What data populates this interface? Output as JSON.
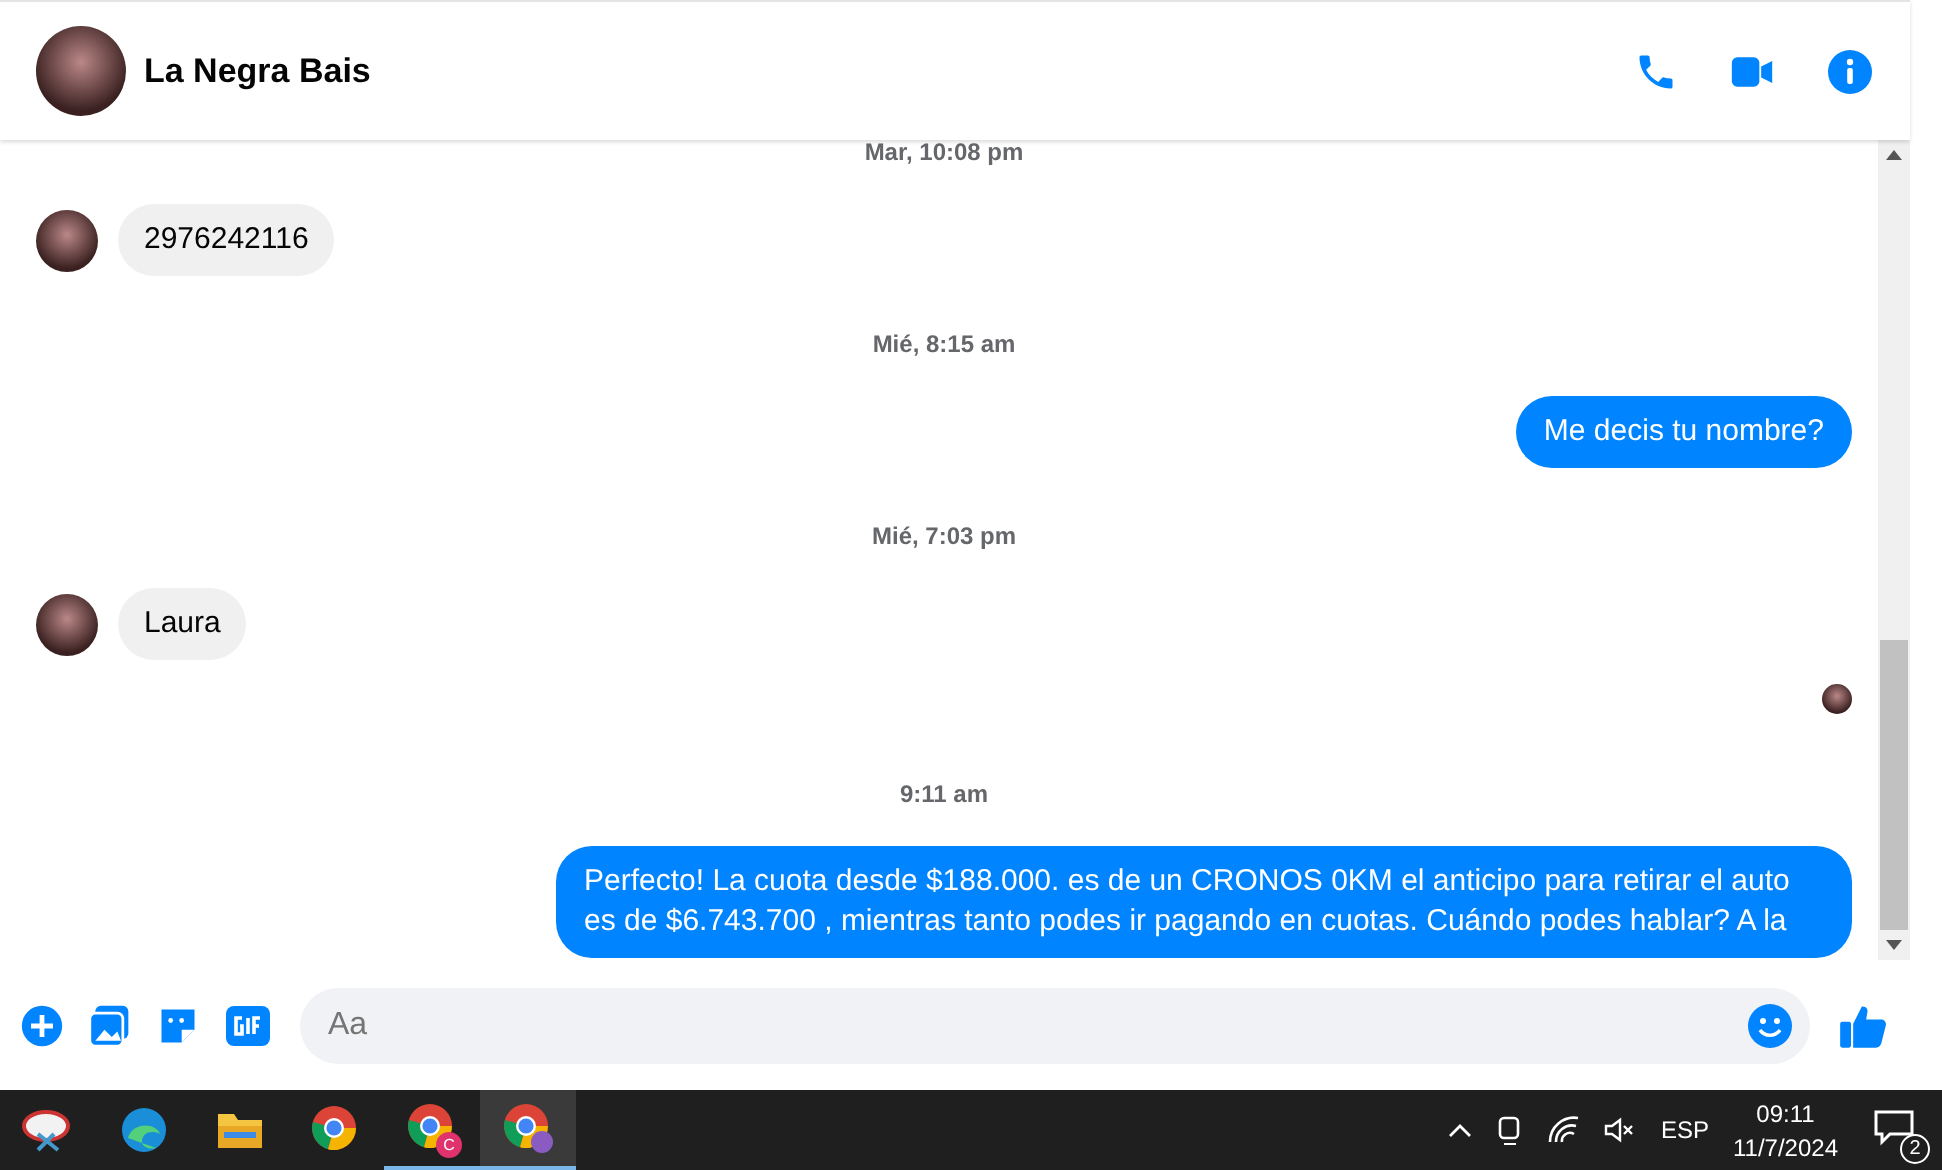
{
  "header": {
    "contact_name": "La Negra Bais"
  },
  "messages": [
    {
      "kind": "timestamp",
      "text": "Mar, 10:08 pm"
    },
    {
      "kind": "incoming",
      "text": "2976242116"
    },
    {
      "kind": "timestamp",
      "text": "Mié, 8:15 am"
    },
    {
      "kind": "outgoing",
      "text": "Me decis tu nombre?"
    },
    {
      "kind": "timestamp",
      "text": "Mié, 7:03 pm"
    },
    {
      "kind": "incoming",
      "text": "Laura"
    },
    {
      "kind": "seen"
    },
    {
      "kind": "timestamp",
      "text": "9:11 am"
    },
    {
      "kind": "outgoing",
      "text": "Perfecto! La cuota desde $188.000. es de un CRONOS 0KM el anticipo para retirar el auto es de $6.743.700 , mientras tanto podes ir pagando en cuotas. Cuándo podes hablar? A la"
    }
  ],
  "composer": {
    "placeholder": "Aa"
  },
  "taskbar": {
    "apps": [
      {
        "kind": "snip",
        "active": false
      },
      {
        "kind": "edge",
        "active": false
      },
      {
        "kind": "folder",
        "active": false
      },
      {
        "kind": "chrome",
        "active": false
      },
      {
        "kind": "chrome-profile",
        "badge": "C",
        "active": true
      },
      {
        "kind": "chrome-incognito",
        "active": true
      }
    ],
    "language": "ESP",
    "time": "09:11",
    "date": "11/7/2024",
    "notifications": "2"
  }
}
